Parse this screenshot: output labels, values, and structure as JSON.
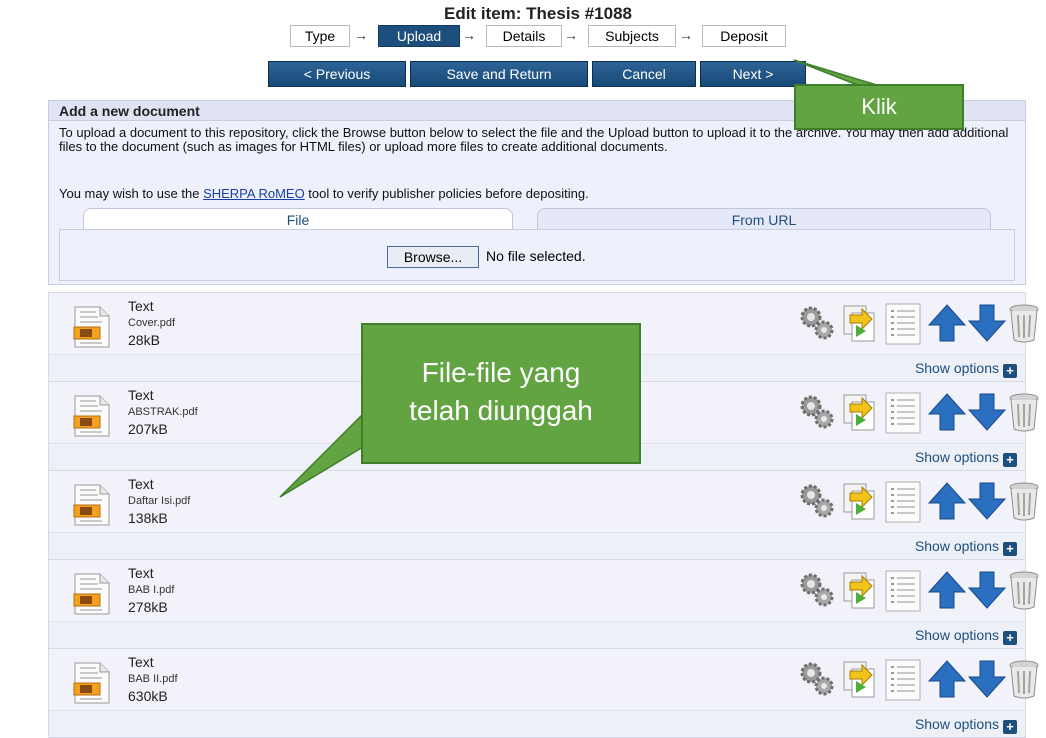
{
  "header": {
    "title": "Edit item: Thesis #1088",
    "steps": [
      "Type",
      "Upload",
      "Details",
      "Subjects",
      "Deposit"
    ],
    "active_step": "Upload"
  },
  "nav": {
    "previous": "< Previous",
    "save": "Save and Return",
    "cancel": "Cancel",
    "next": "Next >"
  },
  "add_doc": {
    "heading": "Add a new document",
    "intro": "To upload a document to this repository, click the Browse button below to select the file and the Upload button to upload it to the archive. You may then add additional files to the document (such as images for HTML files) or upload more files to create additional documents.",
    "romeo_prefix": "You may wish to use the ",
    "romeo_link": "SHERPA RoMEO",
    "romeo_suffix": " tool to verify publisher policies before depositing.",
    "tab_file": "File",
    "tab_url": "From URL",
    "browse_label": "Browse...",
    "no_file": "No file selected."
  },
  "documents": [
    {
      "type": "Text",
      "filename": "Cover.pdf",
      "size": "28kB",
      "show_options": "Show options"
    },
    {
      "type": "Text",
      "filename": "ABSTRAK.pdf",
      "size": "207kB",
      "show_options": "Show options"
    },
    {
      "type": "Text",
      "filename": "Daftar Isi.pdf",
      "size": "138kB",
      "show_options": "Show options"
    },
    {
      "type": "Text",
      "filename": "BAB I.pdf",
      "size": "278kB",
      "show_options": "Show options"
    },
    {
      "type": "Text",
      "filename": "BAB II.pdf",
      "size": "630kB",
      "show_options": "Show options"
    }
  ],
  "doc_icons": [
    "gears-icon",
    "convert-icon",
    "list-icon",
    "arrow-up-icon",
    "arrow-down-icon",
    "trash-icon"
  ],
  "annotations": {
    "klik": "Klik",
    "uploaded_line1": "File-file yang",
    "uploaded_line2": "telah diunggah"
  },
  "colors": {
    "accent": "#1c4f7c",
    "callout": "#62a342",
    "panel": "#eef0fb",
    "arrow_blue": "#2a6fc0"
  }
}
